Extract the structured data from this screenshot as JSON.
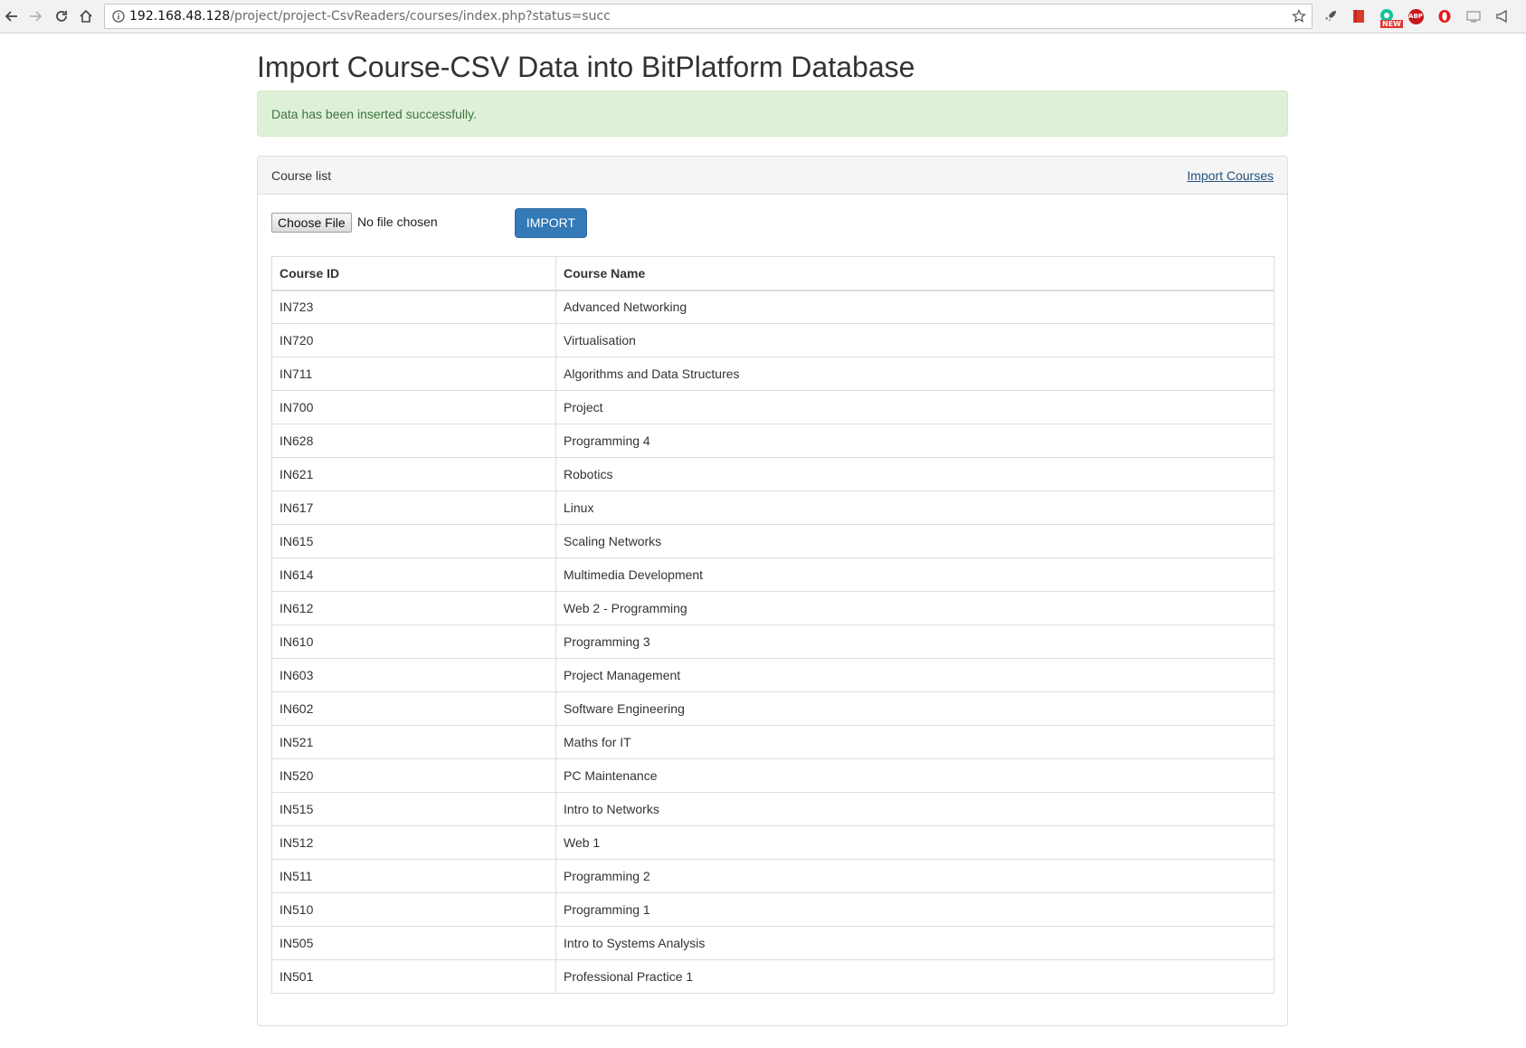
{
  "browser": {
    "url_host": "192.168.48.128",
    "url_path": "/project/project-CsvReaders/courses/index.php?status=succ",
    "extension_new_badge": "NEW",
    "extension_abp_label": "ABP"
  },
  "page": {
    "title": "Import Course-CSV Data into BitPlatform Database",
    "alert_message": "Data has been inserted successfully."
  },
  "panel": {
    "heading": "Course list",
    "import_link": "Import Courses",
    "file_button": "Choose File",
    "file_status": "No file chosen",
    "import_button": "IMPORT"
  },
  "table": {
    "headers": [
      "Course ID",
      "Course Name"
    ],
    "rows": [
      [
        "IN723",
        "Advanced Networking"
      ],
      [
        "IN720",
        "Virtualisation"
      ],
      [
        "IN711",
        "Algorithms and Data Structures"
      ],
      [
        "IN700",
        "Project"
      ],
      [
        "IN628",
        "Programming 4"
      ],
      [
        "IN621",
        "Robotics"
      ],
      [
        "IN617",
        "Linux"
      ],
      [
        "IN615",
        "Scaling Networks"
      ],
      [
        "IN614",
        "Multimedia Development"
      ],
      [
        "IN612",
        "Web 2 - Programming"
      ],
      [
        "IN610",
        "Programming 3"
      ],
      [
        "IN603",
        "Project Management"
      ],
      [
        "IN602",
        "Software Engineering"
      ],
      [
        "IN521",
        "Maths for IT"
      ],
      [
        "IN520",
        "PC Maintenance"
      ],
      [
        "IN515",
        "Intro to Networks"
      ],
      [
        "IN512",
        "Web 1"
      ],
      [
        "IN511",
        "Programming 2"
      ],
      [
        "IN510",
        "Programming 1"
      ],
      [
        "IN505",
        "Intro to Systems Analysis"
      ],
      [
        "IN501",
        "Professional Practice 1"
      ]
    ]
  }
}
